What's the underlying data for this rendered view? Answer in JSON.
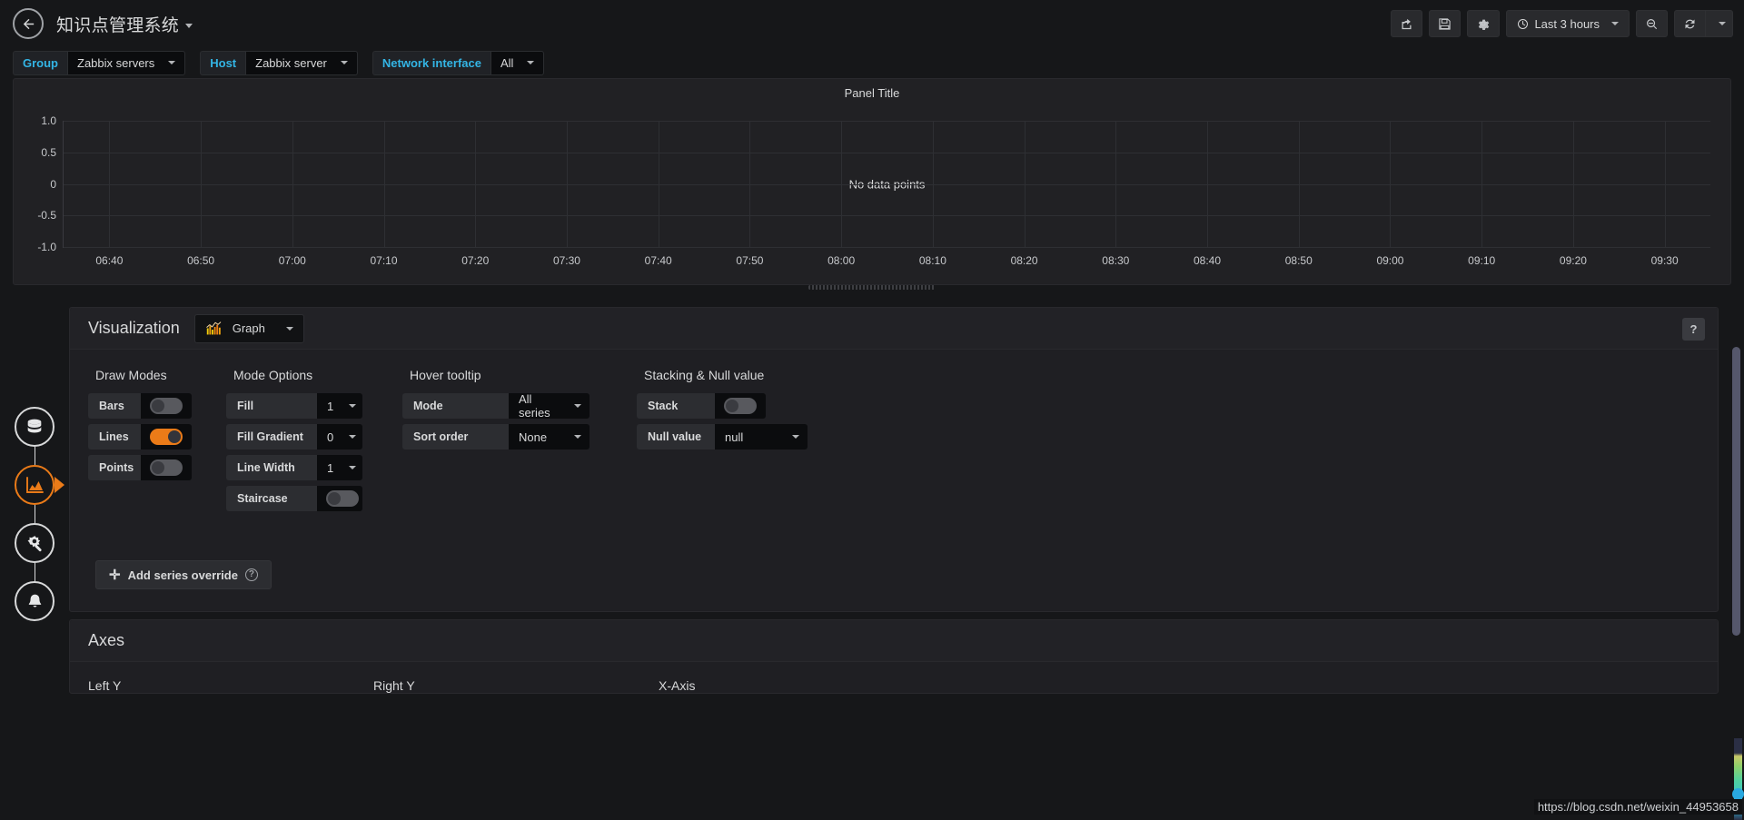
{
  "topnav": {
    "back_icon": "arrow-left-circle-icon",
    "dashboard_title": "知识点管理系统",
    "share_icon": "share-icon",
    "save_icon": "save-icon",
    "settings_icon": "gear-icon",
    "time_clock_icon": "clock-icon",
    "time_range": "Last 3 hours",
    "zoom_out_icon": "zoom-out-icon",
    "refresh_icon": "refresh-icon",
    "refresh_dropdown_icon": "chevron-down-icon"
  },
  "variables": [
    {
      "label": "Group",
      "value": "Zabbix servers"
    },
    {
      "label": "Host",
      "value": "Zabbix server"
    },
    {
      "label": "Network interface",
      "value": "All"
    }
  ],
  "panel": {
    "title": "Panel Title",
    "empty_message": "No data points"
  },
  "chart_data": {
    "type": "line",
    "title": "Panel Title",
    "xlabel": "",
    "ylabel": "",
    "series": [],
    "values": [],
    "x": [
      "06:40",
      "06:50",
      "07:00",
      "07:10",
      "07:20",
      "07:30",
      "07:40",
      "07:50",
      "08:00",
      "08:10",
      "08:20",
      "08:30",
      "08:40",
      "08:50",
      "09:00",
      "09:10",
      "09:20",
      "09:30"
    ],
    "xticks": [
      "06:40",
      "06:50",
      "07:00",
      "07:10",
      "07:20",
      "07:30",
      "07:40",
      "07:50",
      "08:00",
      "08:10",
      "08:20",
      "08:30",
      "08:40",
      "08:50",
      "09:00",
      "09:10",
      "09:20",
      "09:30"
    ],
    "yticks": [
      "1.0",
      "0.5",
      "0",
      "-0.5",
      "-1.0"
    ],
    "ylim": [
      -1.0,
      1.0
    ],
    "grid": true,
    "legend": "none",
    "empty": true,
    "empty_message": "No data points"
  },
  "editor": {
    "visualization": {
      "section_title": "Visualization",
      "picker_icon": "graph-bar-chart-icon",
      "picker_value": "Graph",
      "help_label": "?"
    },
    "draw_modes": {
      "heading": "Draw Modes",
      "rows": [
        {
          "label": "Bars",
          "state": "off"
        },
        {
          "label": "Lines",
          "state": "on"
        },
        {
          "label": "Points",
          "state": "off"
        }
      ]
    },
    "mode_options": {
      "heading": "Mode Options",
      "rows": [
        {
          "label": "Fill",
          "value": "1"
        },
        {
          "label": "Fill Gradient",
          "value": "0"
        },
        {
          "label": "Line Width",
          "value": "1"
        }
      ],
      "staircase": {
        "label": "Staircase",
        "state": "off"
      }
    },
    "hover_tooltip": {
      "heading": "Hover tooltip",
      "rows": [
        {
          "label": "Mode",
          "value": "All series"
        },
        {
          "label": "Sort order",
          "value": "None"
        }
      ]
    },
    "stacking": {
      "heading": "Stacking & Null value",
      "stack": {
        "label": "Stack",
        "state": "off"
      },
      "null_value": {
        "label": "Null value",
        "value": "null"
      }
    },
    "add_override": {
      "plus_icon": "plus-icon",
      "label": "Add series override",
      "help_icon": "question-circle-icon"
    },
    "axes": {
      "section_title": "Axes",
      "columns": [
        "Left Y",
        "Right Y",
        "X-Axis"
      ]
    }
  },
  "edit_rail": [
    {
      "name": "queries",
      "icon": "database-icon",
      "active": false
    },
    {
      "name": "visualization",
      "icon": "area-chart-icon",
      "active": true
    },
    {
      "name": "general",
      "icon": "gear-wrench-icon",
      "active": false
    },
    {
      "name": "alert",
      "icon": "bell-icon",
      "active": false
    }
  ],
  "watermark": "https://blog.csdn.net/weixin_44953658",
  "colors": {
    "accent_orange": "#eb7b18",
    "accent_cyan": "#33b5e5",
    "bg": "#161719",
    "panel_bg": "#212124"
  }
}
